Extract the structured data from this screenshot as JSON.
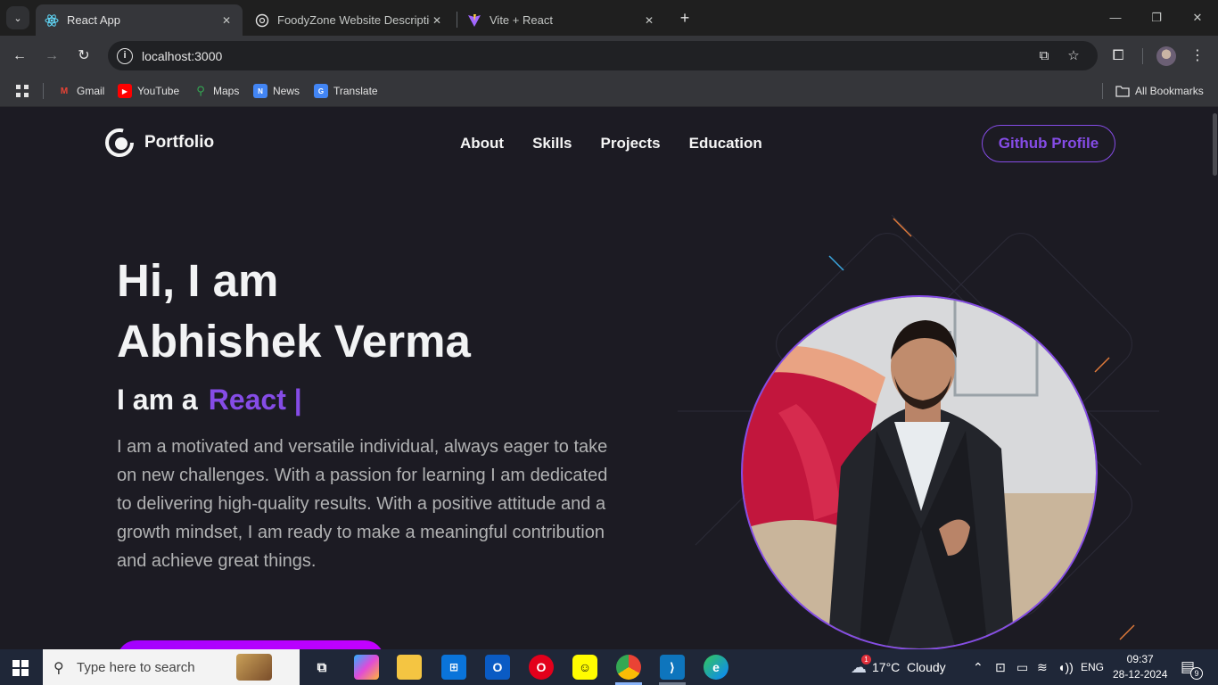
{
  "browser": {
    "tabs": [
      {
        "title": "React App",
        "active": true,
        "icon": "react-icon"
      },
      {
        "title": "FoodyZone Website Description",
        "active": false,
        "icon": "openai-icon"
      },
      {
        "title": "Vite + React",
        "active": false,
        "icon": "vite-icon"
      }
    ],
    "url": "localhost:3000",
    "bookmarks": [
      {
        "label": "Gmail",
        "icon": "gmail-icon"
      },
      {
        "label": "YouTube",
        "icon": "youtube-icon"
      },
      {
        "label": "Maps",
        "icon": "maps-icon"
      },
      {
        "label": "News",
        "icon": "news-icon"
      },
      {
        "label": "Translate",
        "icon": "translate-icon"
      }
    ],
    "all_bookmarks": "All Bookmarks"
  },
  "site": {
    "logo_text": "Portfolio",
    "nav": [
      "About",
      "Skills",
      "Projects",
      "Education"
    ],
    "github_button": "Github Profile",
    "hero": {
      "line1": "Hi, I am",
      "line2": "Abhishek Verma",
      "lead": "I am a",
      "role": "React |",
      "description": "I am a motivated and versatile individual, always eager to take on new challenges. With a passion for learning I am dedicated to delivering high-quality results. With a positive attitude and a growth mindset, I am ready to make a meaningful contribution and achieve great things."
    },
    "colors": {
      "accent": "#854ce6",
      "background": "#1c1b23"
    }
  },
  "taskbar": {
    "search_placeholder": "Type here to search",
    "weather": "17°C  Cloudy",
    "weather_badge": "1",
    "language": "ENG",
    "time": "09:37",
    "date": "28-12-2024",
    "notifications": "9"
  }
}
